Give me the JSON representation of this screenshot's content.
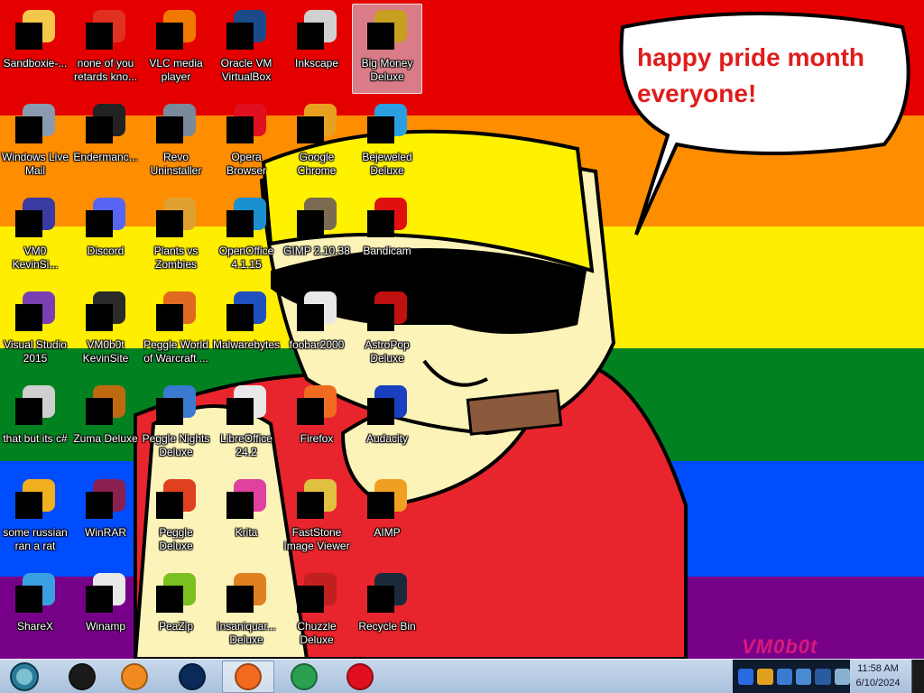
{
  "wallpaper": {
    "stripes": [
      "#e50000",
      "#ff8d00",
      "#ffee00",
      "#028121",
      "#004cff",
      "#770088"
    ],
    "bubble_text": [
      "happy pride month",
      "everyone!"
    ],
    "signature": "VM0b0t"
  },
  "desktop": {
    "columns": [
      [
        {
          "label": "Sandboxie-...",
          "icon": "sandboxie-icon",
          "color": "#f4c84a"
        },
        {
          "label": "Windows Live Mail",
          "icon": "windows-live-mail-icon",
          "color": "#8a9bb0"
        },
        {
          "label": "VM0 KevinSi...",
          "icon": "shortcut-icon",
          "color": "#3a3aa0"
        },
        {
          "label": "Visual Studio 2015",
          "icon": "visual-studio-icon",
          "color": "#7a3fb3"
        },
        {
          "label": "that but its c#",
          "icon": "file-stack-icon",
          "color": "#cfcfcf"
        },
        {
          "label": "some russian ran a rat",
          "icon": "game-icon",
          "color": "#f0b020"
        },
        {
          "label": "ShareX",
          "icon": "sharex-icon",
          "color": "#3aa0e0"
        }
      ],
      [
        {
          "label": "none of you retards kno...",
          "icon": "disc-icon",
          "color": "#e03020"
        },
        {
          "label": "Endermanc...",
          "icon": "terminal-icon",
          "color": "#222222"
        },
        {
          "label": "Discord",
          "icon": "discord-icon",
          "color": "#5865f2"
        },
        {
          "label": "VM0b0t KevinSite",
          "icon": "monitor-icon",
          "color": "#2a2a2a"
        },
        {
          "label": "Zuma Deluxe",
          "icon": "zuma-icon",
          "color": "#c06a10"
        },
        {
          "label": "WinRAR",
          "icon": "winrar-icon",
          "color": "#8a2050"
        },
        {
          "label": "Winamp",
          "icon": "winamp-icon",
          "color": "#e8e8e8"
        }
      ],
      [
        {
          "label": "VLC media player",
          "icon": "vlc-icon",
          "color": "#f07a00"
        },
        {
          "label": "Revo Uninstaller",
          "icon": "revo-icon",
          "color": "#7a8a9a"
        },
        {
          "label": "Plants vs Zombies",
          "icon": "pvz-icon",
          "color": "#e0a030"
        },
        {
          "label": "Peggle World of Warcraft ...",
          "icon": "peggle-wow-icon",
          "color": "#e06a20"
        },
        {
          "label": "Peggle Nights Deluxe",
          "icon": "peggle-nights-icon",
          "color": "#3a7ad0"
        },
        {
          "label": "Peggle Deluxe",
          "icon": "peggle-icon",
          "color": "#e04020"
        },
        {
          "label": "PeaZip",
          "icon": "peazip-icon",
          "color": "#7ac020"
        }
      ],
      [
        {
          "label": "Oracle VM VirtualBox",
          "icon": "virtualbox-icon",
          "color": "#1a4a8a"
        },
        {
          "label": "Opera Browser",
          "icon": "opera-icon",
          "color": "#e01020"
        },
        {
          "label": "OpenOffice 4.1.15",
          "icon": "openoffice-icon",
          "color": "#1a90d0"
        },
        {
          "label": "Malwarebytes",
          "icon": "malwarebytes-icon",
          "color": "#2050c0"
        },
        {
          "label": "LibreOffice 24.2",
          "icon": "libreoffice-icon",
          "color": "#e8e8e8"
        },
        {
          "label": "Krita",
          "icon": "krita-icon",
          "color": "#e040a0"
        },
        {
          "label": "Insaniquar... Deluxe",
          "icon": "insaniquarium-icon",
          "color": "#e08020"
        }
      ],
      [
        {
          "label": "Inkscape",
          "icon": "inkscape-icon",
          "color": "#d0d0d0"
        },
        {
          "label": "Google Chrome",
          "icon": "chrome-icon",
          "color": "#e8a020"
        },
        {
          "label": "GIMP 2.10.38",
          "icon": "gimp-icon",
          "color": "#7a6a50"
        },
        {
          "label": "foobar2000",
          "icon": "foobar-icon",
          "color": "#e8e8e8"
        },
        {
          "label": "Firefox",
          "icon": "firefox-icon",
          "color": "#f06a20"
        },
        {
          "label": "FastStone Image Viewer",
          "icon": "faststone-icon",
          "color": "#e0c040"
        },
        {
          "label": "Chuzzle Deluxe",
          "icon": "chuzzle-icon",
          "color": "#c02020"
        }
      ],
      [
        {
          "label": "Big Money Deluxe",
          "icon": "big-money-icon",
          "color": "#c8a020",
          "selected": true
        },
        {
          "label": "Bejeweled Deluxe",
          "icon": "bejeweled-icon",
          "color": "#2aa0e0"
        },
        {
          "label": "Bandicam",
          "icon": "bandicam-icon",
          "color": "#e01010"
        },
        {
          "label": "AstroPop Deluxe",
          "icon": "astropop-icon",
          "color": "#c01010"
        },
        {
          "label": "Audacity",
          "icon": "audacity-icon",
          "color": "#1a40c0"
        },
        {
          "label": "AIMP",
          "icon": "aimp-icon",
          "color": "#f0a020"
        },
        {
          "label": "Recycle Bin",
          "icon": "recycle-bin-icon",
          "color": "#1a2a3a"
        }
      ]
    ]
  },
  "taskbar": {
    "start_icon": "windows-start-orb-icon",
    "pinned": [
      {
        "name": "taskbar-app-terminal",
        "icon": "dark-window-icon",
        "color": "#1a1a1a",
        "active": false
      },
      {
        "name": "taskbar-app-media",
        "icon": "media-player-icon",
        "color": "#f08a20",
        "active": false
      },
      {
        "name": "taskbar-app-globe",
        "icon": "globe-icon",
        "color": "#0a2a5a",
        "active": false
      },
      {
        "name": "taskbar-app-firefox",
        "icon": "firefox-icon",
        "color": "#f06a20",
        "active": true
      },
      {
        "name": "taskbar-app-chrome",
        "icon": "chrome-icon",
        "color": "#2aa050",
        "active": false
      },
      {
        "name": "taskbar-app-opera",
        "icon": "opera-icon",
        "color": "#e01020",
        "active": false
      }
    ],
    "tray_icons": [
      {
        "icon": "malwarebytes-tray-icon",
        "color": "#2a6ae0"
      },
      {
        "icon": "chrome-tray-icon",
        "color": "#e0a020"
      },
      {
        "icon": "shield-tray-icon",
        "color": "#3a7ad0"
      },
      {
        "icon": "network-tray-icon",
        "color": "#4a8ad0"
      },
      {
        "icon": "display-tray-icon",
        "color": "#2a5aa0"
      },
      {
        "icon": "volume-tray-icon",
        "color": "#8ab0d0"
      }
    ],
    "clock": {
      "time": "11:58 AM",
      "date": "6/10/2024"
    }
  }
}
